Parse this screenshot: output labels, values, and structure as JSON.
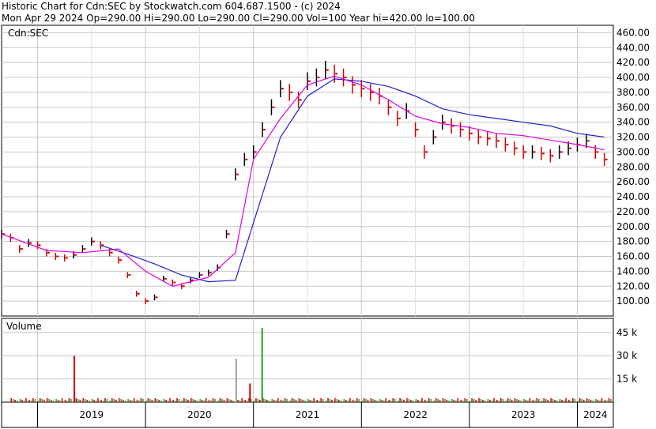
{
  "header": {
    "line1": "Historic Chart for Cdn:SEC by Stockwatch.com 604.687.1500 - (c) 2024",
    "line2": "Mon Apr 29 2024   Op=290.00   Hi=290.00   Lo=290.00   Cl=290.00   Vol=100   Year hi=420.00   lo=100.00"
  },
  "price_panel": {
    "label": "Cdn:SEC"
  },
  "volume_panel": {
    "label": "Volume"
  },
  "colors": {
    "ma_short": "#e000e0",
    "ma_long": "#2020d0",
    "bar_up": "#000000",
    "bar_down": "#d00000",
    "vol_up": "#20a020",
    "vol_down": "#d00000",
    "vol_flat": "#a0a0a0",
    "grid": "#c8c8c8"
  },
  "chart_data": [
    {
      "type": "line",
      "title": "Cdn:SEC",
      "ylim": [
        80,
        470
      ],
      "y_ticks": [
        "460.00",
        "440.00",
        "420.00",
        "400.00",
        "380.00",
        "360.00",
        "340.00",
        "320.00",
        "300.00",
        "280.00",
        "260.00",
        "240.00",
        "220.00",
        "200.00",
        "180.00",
        "160.00",
        "140.00",
        "120.00",
        "100.00"
      ],
      "x_ticks": [
        "2019",
        "2020",
        "2021",
        "2022",
        "2023",
        "2024"
      ],
      "x_range": [
        "2018-09",
        "2024-05"
      ],
      "series": [
        {
          "role": "price",
          "x": [
            "2018-09",
            "2018-10",
            "2018-11",
            "2018-12",
            "2019-01",
            "2019-02",
            "2019-03",
            "2019-04",
            "2019-05",
            "2019-06",
            "2019-07",
            "2019-08",
            "2019-09",
            "2019-10",
            "2019-11",
            "2019-12",
            "2020-01",
            "2020-02",
            "2020-03",
            "2020-04",
            "2020-05",
            "2020-06",
            "2020-07",
            "2020-08",
            "2020-09",
            "2020-10",
            "2020-11",
            "2020-12",
            "2021-01",
            "2021-02",
            "2021-03",
            "2021-04",
            "2021-05",
            "2021-06",
            "2021-07",
            "2021-08",
            "2021-09",
            "2021-10",
            "2021-11",
            "2021-12",
            "2022-01",
            "2022-02",
            "2022-03",
            "2022-04",
            "2022-05",
            "2022-06",
            "2022-07",
            "2022-08",
            "2022-09",
            "2022-10",
            "2022-11",
            "2022-12",
            "2023-01",
            "2023-02",
            "2023-03",
            "2023-04",
            "2023-05",
            "2023-06",
            "2023-07",
            "2023-08",
            "2023-09",
            "2023-10",
            "2023-11",
            "2023-12",
            "2024-01",
            "2024-02",
            "2024-03",
            "2024-04"
          ],
          "values": [
            190,
            185,
            170,
            178,
            175,
            165,
            160,
            158,
            162,
            170,
            180,
            175,
            165,
            155,
            135,
            110,
            100,
            105,
            130,
            125,
            120,
            128,
            135,
            138,
            145,
            190,
            270,
            290,
            300,
            330,
            360,
            385,
            380,
            370,
            395,
            400,
            410,
            405,
            400,
            390,
            385,
            380,
            375,
            360,
            345,
            355,
            330,
            300,
            320,
            340,
            335,
            330,
            325,
            320,
            318,
            315,
            310,
            305,
            300,
            300,
            298,
            295,
            300,
            305,
            310,
            315,
            300,
            290
          ]
        },
        {
          "role": "short moving average",
          "x": [
            "2018-09",
            "2019-02",
            "2019-06",
            "2019-10",
            "2020-01",
            "2020-04",
            "2020-08",
            "2020-11",
            "2021-01",
            "2021-04",
            "2021-07",
            "2021-10",
            "2022-01",
            "2022-04",
            "2022-07",
            "2022-10",
            "2023-01",
            "2023-04",
            "2023-07",
            "2023-10",
            "2024-01",
            "2024-04"
          ],
          "values": [
            190,
            168,
            165,
            170,
            140,
            120,
            132,
            165,
            290,
            345,
            390,
            402,
            390,
            370,
            348,
            338,
            333,
            325,
            322,
            316,
            310,
            303
          ]
        },
        {
          "role": "long moving average",
          "x": [
            "2019-08",
            "2019-11",
            "2020-02",
            "2020-05",
            "2020-08",
            "2020-11",
            "2021-01",
            "2021-04",
            "2021-07",
            "2021-10",
            "2022-01",
            "2022-04",
            "2022-07",
            "2022-10",
            "2023-01",
            "2023-04",
            "2023-07",
            "2023-10",
            "2024-01",
            "2024-04"
          ],
          "values": [
            175,
            163,
            150,
            135,
            126,
            128,
            205,
            320,
            375,
            398,
            395,
            388,
            375,
            358,
            350,
            345,
            340,
            335,
            325,
            320
          ]
        }
      ]
    },
    {
      "type": "bar",
      "title": "Volume",
      "y_ticks": [
        "45 k",
        "30 k",
        "15 k"
      ],
      "ylim": [
        0,
        50
      ],
      "x": [
        "2019-05",
        "2020-11",
        "2020-12",
        "2021-01"
      ],
      "values": [
        30,
        28,
        12,
        48
      ]
    }
  ]
}
